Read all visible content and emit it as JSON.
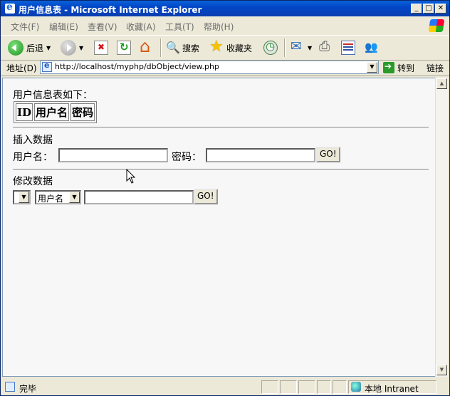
{
  "window": {
    "title": "用户信息表 - Microsoft Internet Explorer"
  },
  "menu": [
    "文件(F)",
    "编辑(E)",
    "查看(V)",
    "收藏(A)",
    "工具(T)",
    "帮助(H)"
  ],
  "toolbar": {
    "back": "后退",
    "search": "搜索",
    "favorites": "收藏夹"
  },
  "address": {
    "label": "地址(D)",
    "url": "http://localhost/myphp/dbObject/view.php",
    "go": "转到",
    "links": "链接"
  },
  "page": {
    "intro": "用户信息表如下：",
    "table_headers": [
      "ID",
      "用户名",
      "密码"
    ],
    "insert_heading": "插入数据",
    "username_label": "用户名：",
    "password_label": "密码：",
    "insert_go": "GO!",
    "modify_heading": "修改数据",
    "modify_select_value": "",
    "field_select_value": "用户名",
    "modify_go": "GO!"
  },
  "status": {
    "text": "完毕",
    "zone": "本地 Intranet"
  }
}
